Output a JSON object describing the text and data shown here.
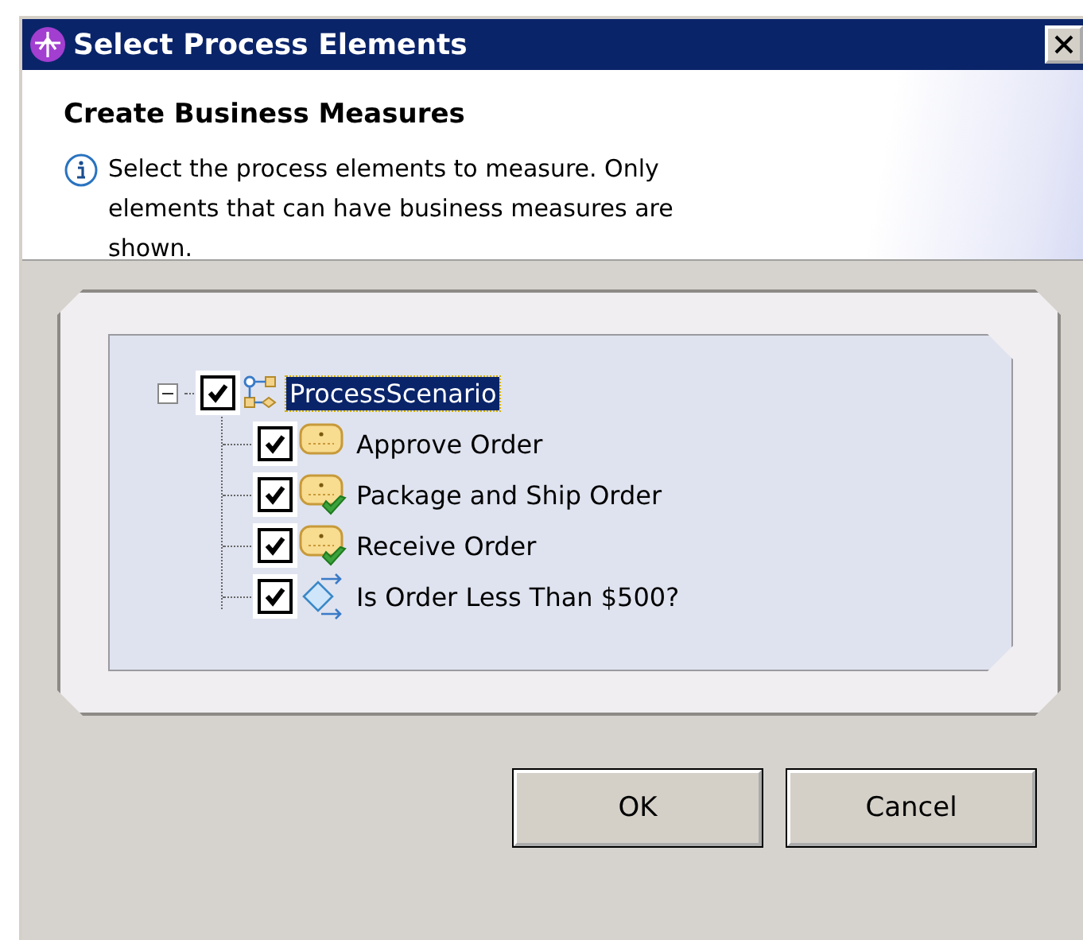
{
  "window": {
    "title": "Select Process Elements"
  },
  "header": {
    "title": "Create Business Measures",
    "message": "Select the process elements to measure. Only elements that can have business measures are shown."
  },
  "tree": [
    {
      "label": "ProcessScenario",
      "kind": "scenario",
      "checked": true,
      "selected": true,
      "expanded": true,
      "children": [
        {
          "label": "Approve Order",
          "kind": "task",
          "checked": true,
          "selected": false
        },
        {
          "label": "Package and Ship Order",
          "kind": "task_done",
          "checked": true,
          "selected": false
        },
        {
          "label": "Receive Order",
          "kind": "task_done",
          "checked": true,
          "selected": false
        },
        {
          "label": "Is Order Less Than  $500?",
          "kind": "decision",
          "checked": true,
          "selected": false
        }
      ]
    }
  ],
  "buttons": [
    "OK",
    "Cancel"
  ]
}
